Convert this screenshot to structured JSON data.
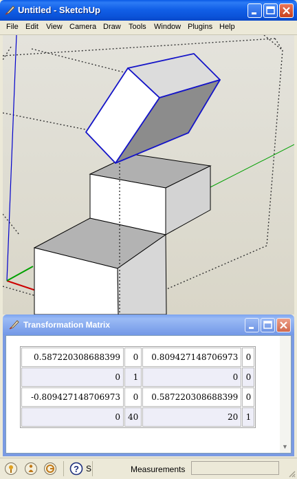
{
  "window": {
    "title": "Untitled - SketchUp"
  },
  "menu": [
    "File",
    "Edit",
    "View",
    "Camera",
    "Draw",
    "Tools",
    "Window",
    "Plugins",
    "Help"
  ],
  "dialog": {
    "title": "Transformation Matrix",
    "matrix": [
      [
        "0.587220308688399",
        "0",
        "0.809427148706973",
        "0"
      ],
      [
        "0",
        "1",
        "0",
        "0"
      ],
      [
        "-0.809427148706973",
        "0",
        "0.587220308688399",
        "0"
      ],
      [
        "0",
        "40",
        "20",
        "1"
      ]
    ]
  },
  "statusbar": {
    "truncated_hint": "S",
    "measurements_label": "Measurements",
    "measurements_value": ""
  },
  "axes_colors": {
    "red": "#cc0000",
    "green": "#00a000",
    "blue": "#0000cc"
  },
  "selection_color": "#1414c8",
  "icons": [
    "sketchup-app-icon",
    "minimize-icon",
    "maximize-icon",
    "close-icon",
    "geo-location-icon",
    "credits-icon",
    "sign-in-icon",
    "help-icon"
  ]
}
